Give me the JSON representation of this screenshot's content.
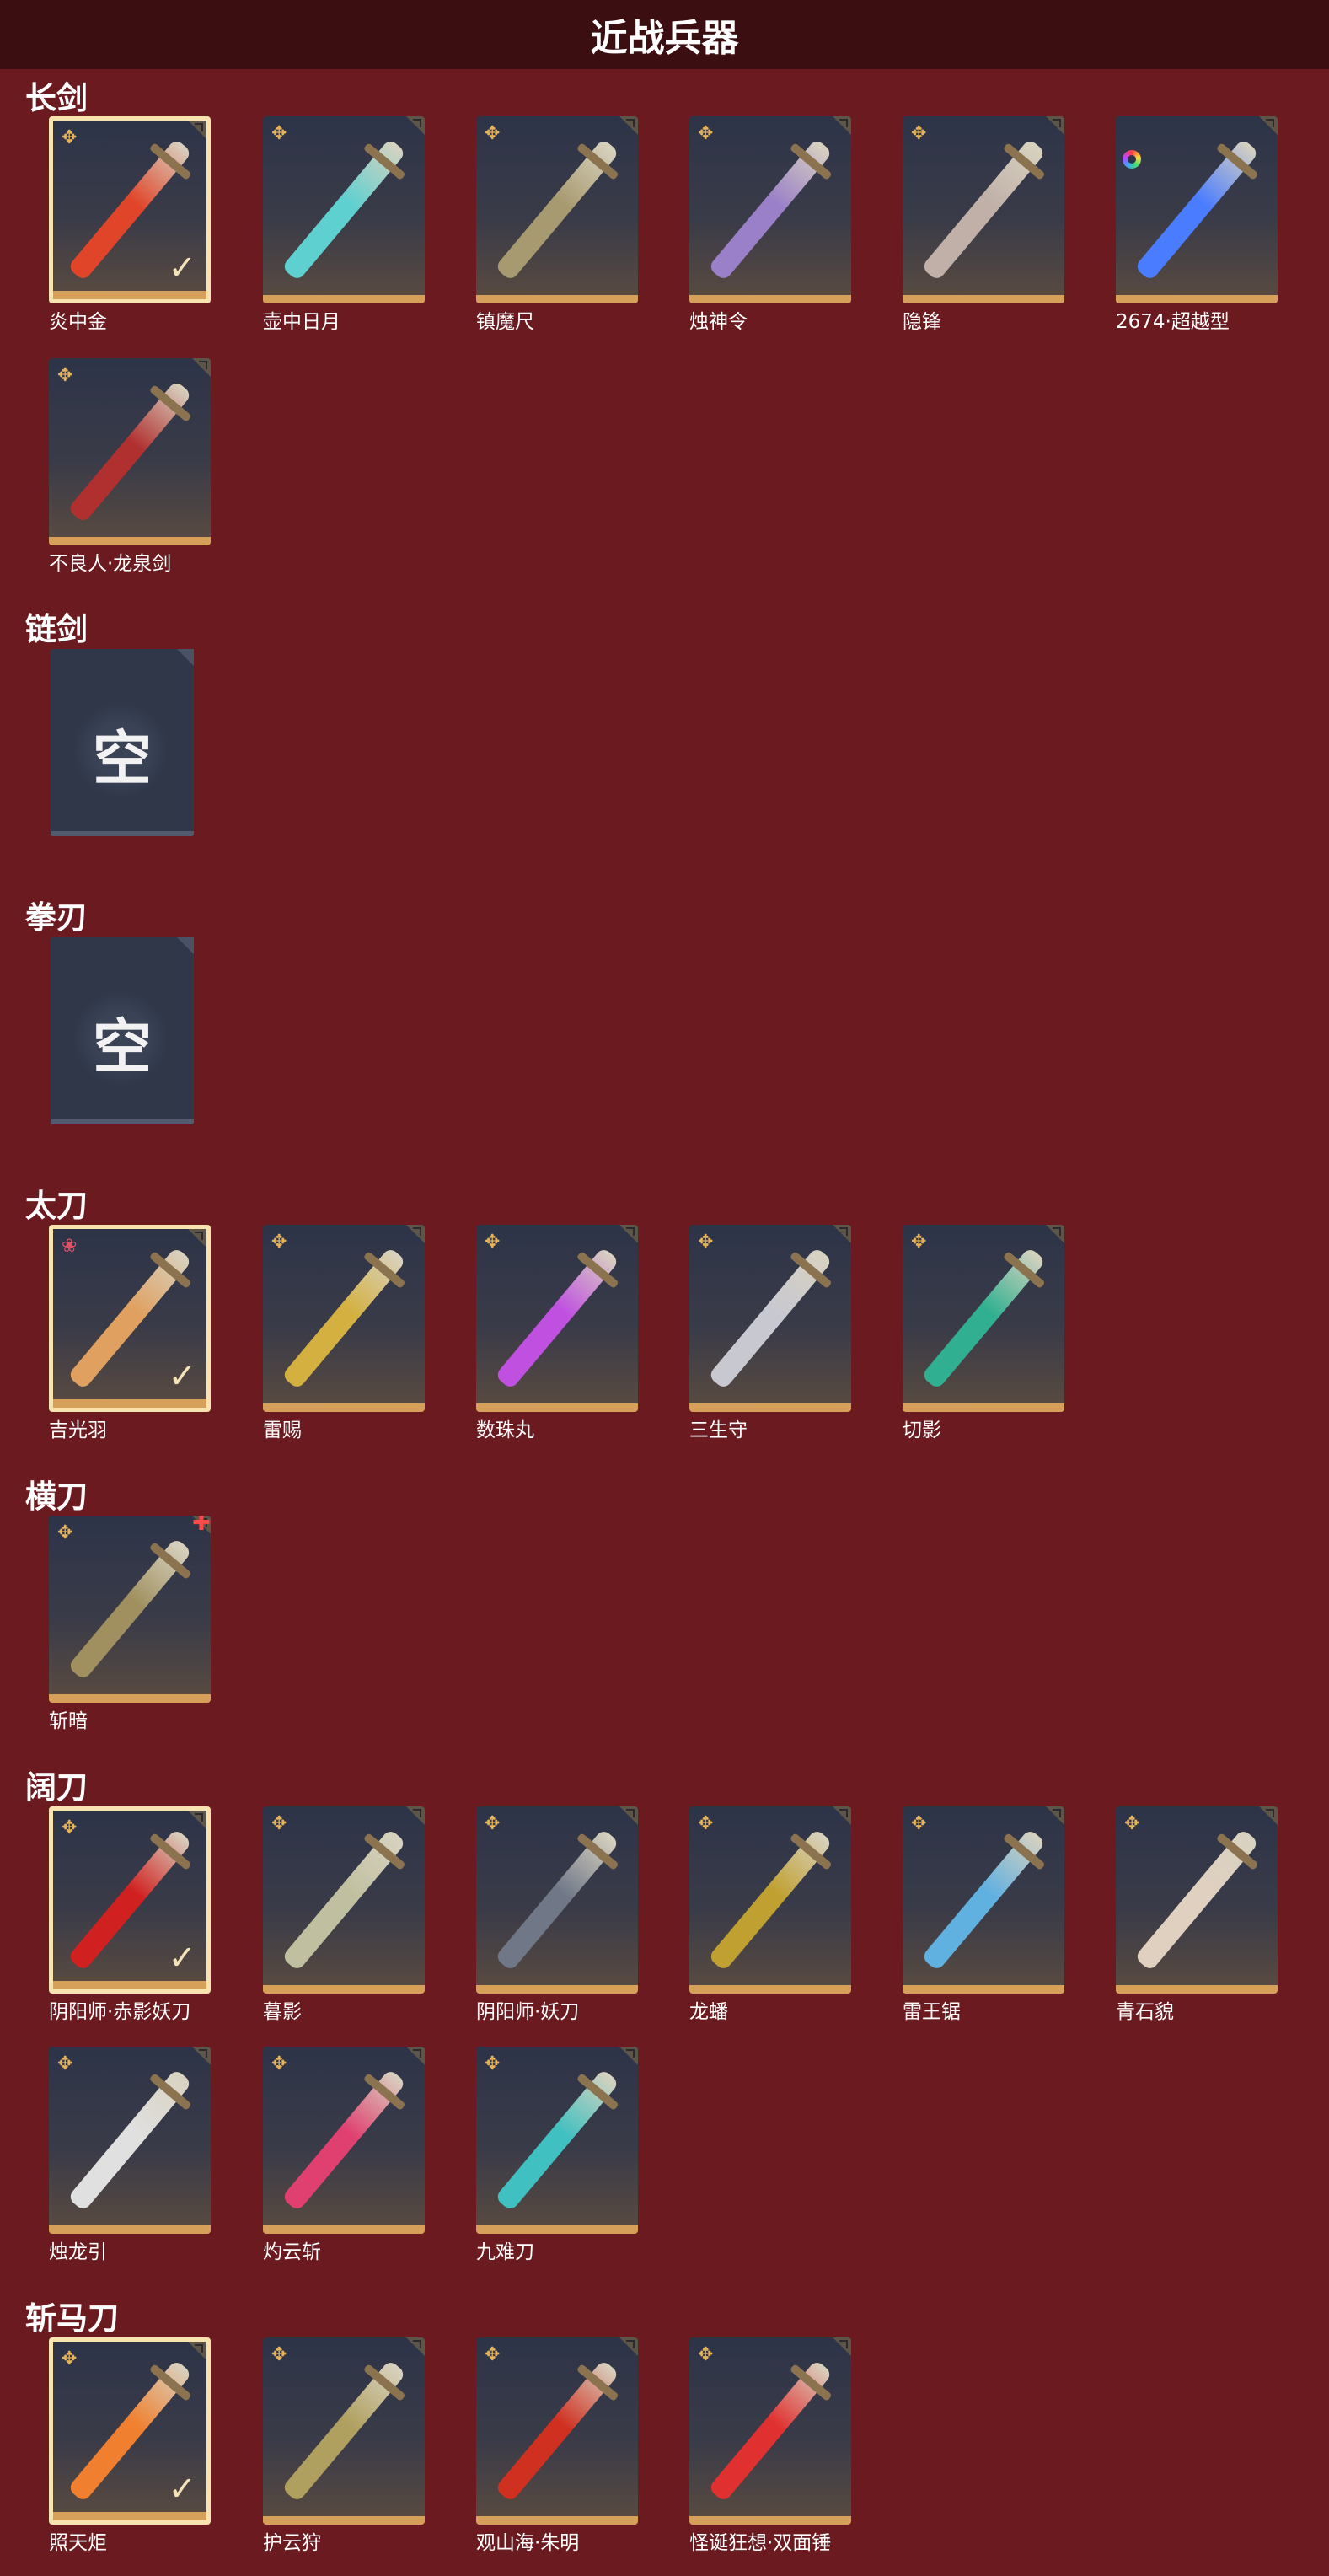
{
  "header": {
    "title": "近战兵器"
  },
  "empty_label": "空",
  "sections": {
    "s0": {
      "title": "长剑"
    },
    "s1": {
      "title": "链剑"
    },
    "s2": {
      "title": "拳刃"
    },
    "s3": {
      "title": "太刀"
    },
    "s4": {
      "title": "横刀"
    },
    "s5": {
      "title": "阔刀"
    },
    "s6": {
      "title": "斩马刀"
    }
  },
  "weapons": {
    "w0": {
      "name": "炎中金",
      "rarity": "gold",
      "selected": true,
      "color": "#e0452a"
    },
    "w1": {
      "name": "壶中日月",
      "rarity": "gold",
      "selected": false,
      "color": "#5fd0d0"
    },
    "w2": {
      "name": "镇魔尺",
      "rarity": "gold",
      "selected": false,
      "color": "#a89a70"
    },
    "w3": {
      "name": "烛神令",
      "rarity": "gold",
      "selected": false,
      "color": "#9a80c8"
    },
    "w4": {
      "name": "隐锋",
      "rarity": "gold",
      "selected": false,
      "color": "#c0b0a8"
    },
    "w5": {
      "name": "2674·超越型",
      "rarity": "rainbow",
      "selected": false,
      "color": "#4a7cff"
    },
    "w6": {
      "name": "不良人·龙泉剑",
      "rarity": "gold",
      "selected": false,
      "color": "#b03030"
    },
    "w7": {
      "name": "吉光羽",
      "rarity": "red",
      "selected": true,
      "color": "#e0a060"
    },
    "w8": {
      "name": "雷赐",
      "rarity": "gold",
      "selected": false,
      "color": "#d4b040"
    },
    "w9": {
      "name": "数珠丸",
      "rarity": "gold",
      "selected": false,
      "color": "#c050e0"
    },
    "w10": {
      "name": "三生守",
      "rarity": "gold",
      "selected": false,
      "color": "#c8c8d0"
    },
    "w11": {
      "name": "切影",
      "rarity": "gold",
      "selected": false,
      "color": "#30b090"
    },
    "w12": {
      "name": "斩暗",
      "rarity": "gold",
      "selected": false,
      "color": "#a09060"
    },
    "w13": {
      "name": "阴阳师·赤影妖刀",
      "rarity": "gold",
      "selected": true,
      "color": "#d02020"
    },
    "w14": {
      "name": "暮影",
      "rarity": "gold",
      "selected": false,
      "color": "#c0c0a0"
    },
    "w15": {
      "name": "阴阳师·妖刀",
      "rarity": "gold",
      "selected": false,
      "color": "#707888"
    },
    "w16": {
      "name": "龙蟠",
      "rarity": "gold",
      "selected": false,
      "color": "#c0a030"
    },
    "w17": {
      "name": "雷王锯",
      "rarity": "gold",
      "selected": false,
      "color": "#60b0e0"
    },
    "w18": {
      "name": "青石貌",
      "rarity": "gold",
      "selected": false,
      "color": "#e0d0c0"
    },
    "w19": {
      "name": "烛龙引",
      "rarity": "gold",
      "selected": false,
      "color": "#e0e0e0"
    },
    "w20": {
      "name": "灼云斩",
      "rarity": "gold",
      "selected": false,
      "color": "#e04070"
    },
    "w21": {
      "name": "九难刀",
      "rarity": "gold",
      "selected": false,
      "color": "#40c0c0"
    },
    "w22": {
      "name": "照天炬",
      "rarity": "gold",
      "selected": true,
      "color": "#f08030"
    },
    "w23": {
      "name": "护云狩",
      "rarity": "gold",
      "selected": false,
      "color": "#b0a060"
    },
    "w24": {
      "name": "观山海·朱明",
      "rarity": "gold",
      "selected": false,
      "color": "#d03020"
    },
    "w25": {
      "name": "怪诞狂想·双面锤",
      "rarity": "gold",
      "selected": false,
      "color": "#e03030"
    }
  }
}
